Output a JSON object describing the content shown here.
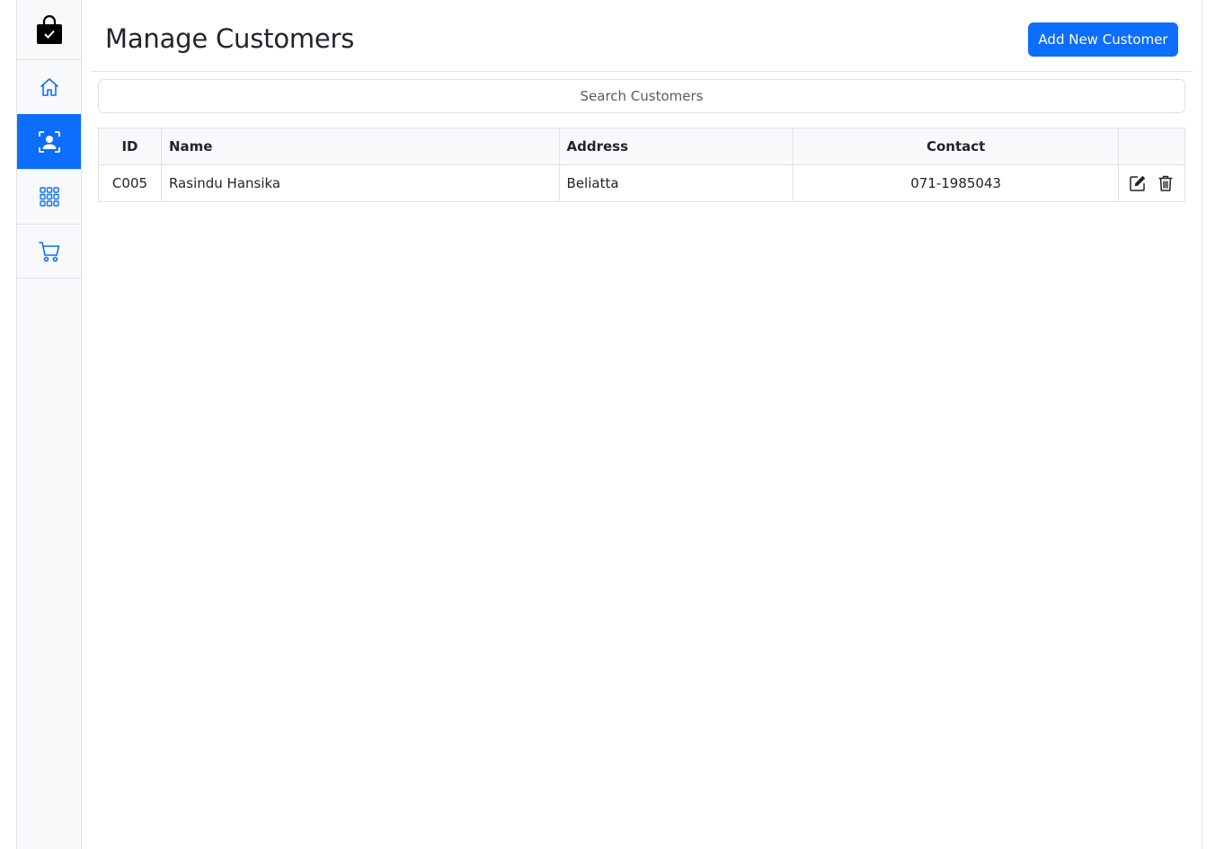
{
  "sidebar": {
    "logo_icon": "shopping-bag-check-icon",
    "items": [
      {
        "name": "home",
        "icon": "house-icon",
        "active": false
      },
      {
        "name": "customers",
        "icon": "person-bounding-box-icon",
        "active": true
      },
      {
        "name": "items",
        "icon": "grid-icon",
        "active": false
      },
      {
        "name": "orders",
        "icon": "cart-icon",
        "active": false
      }
    ]
  },
  "header": {
    "title": "Manage Customers",
    "add_button_label": "Add New Customer"
  },
  "search": {
    "placeholder": "Search Customers",
    "value": ""
  },
  "table": {
    "columns": [
      "ID",
      "Name",
      "Address",
      "Contact",
      ""
    ],
    "rows": [
      {
        "id": "C005",
        "name": "Rasindu Hansika",
        "address": "Beliatta",
        "contact": "071-1985043"
      }
    ]
  },
  "colors": {
    "accent": "#0d6efd",
    "sidebar_bg": "#f8f9fa",
    "border": "#dee2e6"
  }
}
